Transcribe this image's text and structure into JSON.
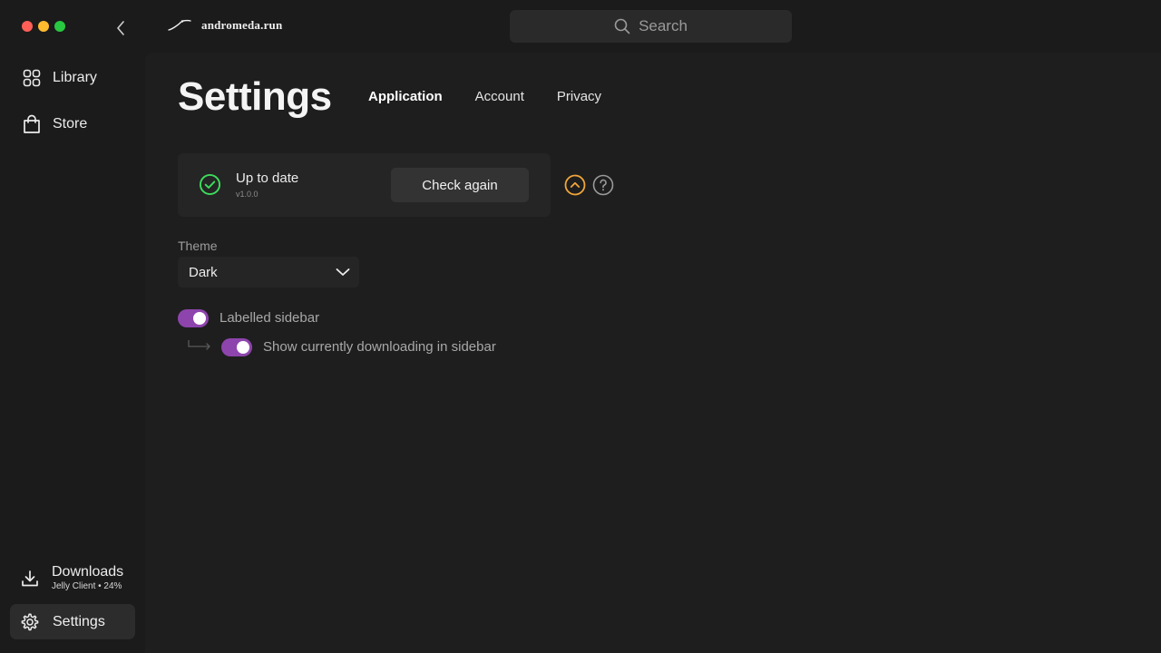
{
  "window": {
    "brand_name": "andromeda.run",
    "colors": {
      "close": "#ff5f57",
      "minimize": "#febc2e",
      "zoom": "#28c840"
    }
  },
  "search": {
    "placeholder": "Search"
  },
  "sidebar": {
    "items": [
      {
        "label": "Library",
        "icon": "grid-icon"
      },
      {
        "label": "Store",
        "icon": "shopping-bag-icon"
      }
    ],
    "downloads": {
      "label": "Downloads",
      "detail": "Jelly Client • 24%",
      "icon": "download-icon"
    },
    "settings": {
      "label": "Settings",
      "icon": "gear-icon"
    }
  },
  "main": {
    "title": "Settings",
    "tabs": [
      {
        "label": "Application",
        "active": true
      },
      {
        "label": "Account",
        "active": false
      },
      {
        "label": "Privacy",
        "active": false
      }
    ],
    "update": {
      "status": "Up to date",
      "version": "v1.0.0",
      "button_label": "Check again",
      "status_color": "#3ddc5c"
    },
    "theme": {
      "label": "Theme",
      "value": "Dark"
    },
    "toggles": [
      {
        "label": "Labelled sidebar",
        "on": true
      },
      {
        "label": "Show currently downloading in sidebar",
        "on": true
      }
    ],
    "accent_color": "#8e44ad"
  }
}
